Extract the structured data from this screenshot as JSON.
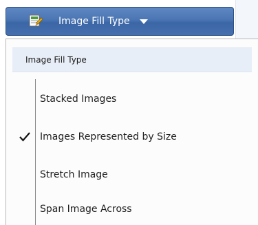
{
  "toolbar": {
    "button_label": "Image Fill Type",
    "button_icon": "image-fill-icon",
    "dropdown_icon": "chevron-down-icon"
  },
  "menu": {
    "header": "Image Fill Type",
    "items": [
      {
        "label": "Stacked Images",
        "checked": false
      },
      {
        "label": "Images Represented by Size",
        "checked": true
      },
      {
        "label": "Stretch Image",
        "checked": false
      },
      {
        "label": "Span Image Across",
        "checked": false
      }
    ],
    "check_icon": "checkmark-icon"
  },
  "colors": {
    "button_bg": "#4a75b3",
    "button_text": "#ffffff",
    "header_bg": "#e8eef7"
  }
}
